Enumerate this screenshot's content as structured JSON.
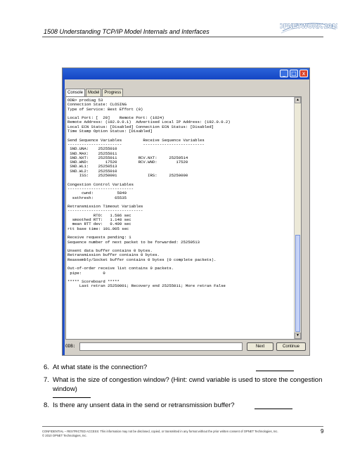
{
  "header": {
    "title": "1508 Understanding TCP/IP Model Internals and Interfaces",
    "logo_text": "OPNETWORK 2010"
  },
  "window": {
    "tabs": [
      "Console",
      "Model",
      "Progress"
    ],
    "title_buttons": {
      "minimize": "_",
      "maximize": "□",
      "close": "x"
    },
    "console_lines": [
      "ODB> prodiag 53",
      "Connection State: CLOSING",
      "Type of Service: Best Effort (0)",
      "",
      "Local Port: [  20]    Remote Port: (1024)",
      "Remote Address: (192.0.0.1)  Advertised Local IP Address: (192.0.0.2)",
      "Local ECN Status: [Disabled] Connection ECN Status: [Disabled]",
      "Time Stamp Option Status: [Disabled]",
      "",
      "Send Sequence Variables         Receive Sequence Variables",
      "-----------------------         --------------------------",
      " SND.UNA:    25255010",
      " SND.MAX:    25255011",
      " SND.NXT:    25255011         RCV.NXT:     25250514",
      " SND.WND:       17520         RCV.WND:        17520",
      " SND.WL1:    25250513",
      " SND.WL2:    25255010",
      "     ISS:    25250001             IRS:     25250000",
      "",
      "Congestion Control Variables",
      "----------------------------",
      "      cwnd:          5840",
      "  ssthresh:         65535",
      "",
      "Retransmission Timeout Variables",
      "--------------------------------",
      "           RTO:   1.586 sec",
      "  smoothed RTT:   1.148 sec",
      "  mean RTT dev:   0.409 sec",
      "rtt base time: 101.005 sec",
      "",
      "Receive requests pending: 1",
      "Sequence number of next packet to be forwarded: 25250513",
      "",
      "Unsent data buffer contains 0 bytes.",
      "Retransmission buffer contains 0 bytes.",
      "Reassembly/Socket buffer contains 0 bytes (0 complete packets).",
      "",
      "Out-of-order receive list contains 0 packets.",
      " pipe:         0",
      "",
      "***** Scoreboard *****",
      "     Last retran 25250001; Recovery end 25255011; More retran False"
    ],
    "command_label": "ODB:",
    "next_button": "Next",
    "continue_button": "Continue"
  },
  "questions": [
    {
      "number": "6.",
      "text": "At what state is the connection?"
    },
    {
      "number": "7.",
      "text": "What is the size of congestion window? (Hint: cwnd variable is used to store the congestion",
      "text2": "window)"
    },
    {
      "number": "8.",
      "text": "Is there any unsent data in the send or retransmission buffer?"
    }
  ],
  "footer": {
    "line1": "CONFIDENTIAL – RESTRICTED ACCESS: This information may not be disclosed, copied, or transmitted in any format without the prior written consent of OPNET Technologies, Inc.",
    "line2": "© 2010 OPNET Technologies, Inc.",
    "page_number": "9"
  }
}
